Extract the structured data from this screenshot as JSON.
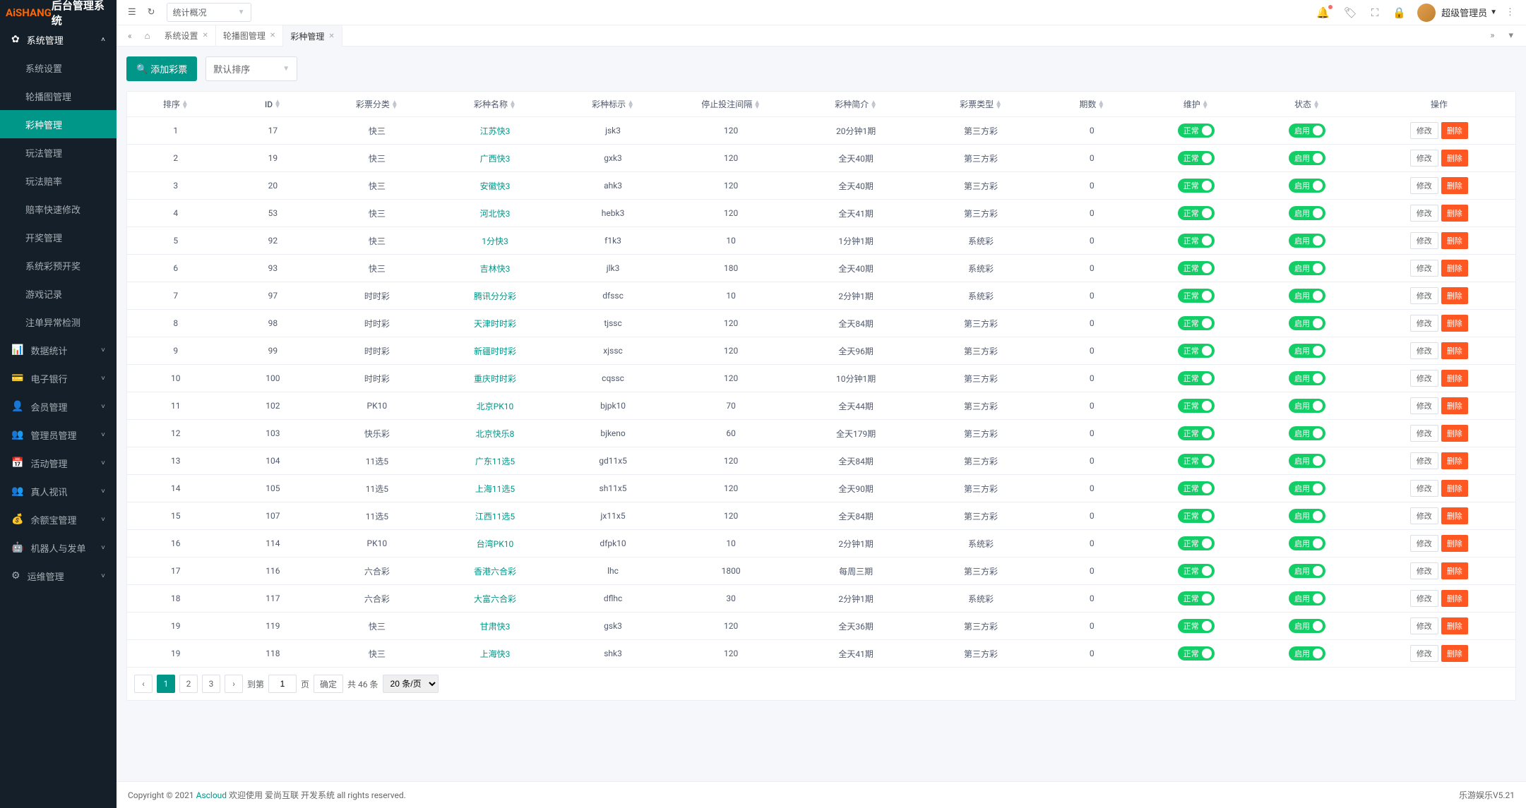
{
  "logo": {
    "part1": "AiSHANG",
    "part2": "后台管理系统"
  },
  "topbar": {
    "dropdown_label": "统计概况",
    "user_name": "超级管理员"
  },
  "tabs": [
    {
      "label": "系统设置",
      "active": false
    },
    {
      "label": "轮播图管理",
      "active": false
    },
    {
      "label": "彩种管理",
      "active": true
    }
  ],
  "sidebar": {
    "group1_label": "系统管理",
    "items": [
      {
        "label": "系统设置"
      },
      {
        "label": "轮播图管理"
      },
      {
        "label": "彩种管理"
      },
      {
        "label": "玩法管理"
      },
      {
        "label": "玩法赔率"
      },
      {
        "label": "赔率快速修改"
      },
      {
        "label": "开奖管理"
      },
      {
        "label": "系统彩预开奖"
      },
      {
        "label": "游戏记录"
      },
      {
        "label": "注单异常检测"
      }
    ],
    "collapsed_groups": [
      {
        "icon": "📊",
        "label": "数据统计"
      },
      {
        "icon": "💳",
        "label": "电子银行"
      },
      {
        "icon": "👤",
        "label": "会员管理"
      },
      {
        "icon": "👥",
        "label": "管理员管理"
      },
      {
        "icon": "📅",
        "label": "活动管理"
      },
      {
        "icon": "👥",
        "label": "真人视讯"
      },
      {
        "icon": "💰",
        "label": "余额宝管理"
      },
      {
        "icon": "🤖",
        "label": "机器人与发单"
      },
      {
        "icon": "⚙",
        "label": "运维管理"
      }
    ]
  },
  "toolbar": {
    "add_label": "添加彩票",
    "sort_label": "默认排序"
  },
  "table": {
    "headers": [
      "排序",
      "ID",
      "彩票分类",
      "彩种名称",
      "彩种标示",
      "停止投注间隔",
      "彩种简介",
      "彩票类型",
      "期数",
      "维护",
      "状态",
      "操作"
    ],
    "toggle_maintain": "正常",
    "toggle_status": "启用",
    "btn_edit": "修改",
    "btn_delete": "删除",
    "rows": [
      {
        "sort": "1",
        "id": "17",
        "cat": "快三",
        "name": "江苏快3",
        "code": "jsk3",
        "stop": "120",
        "intro": "20分钟1期",
        "type": "第三方彩",
        "periods": "0"
      },
      {
        "sort": "2",
        "id": "19",
        "cat": "快三",
        "name": "广西快3",
        "code": "gxk3",
        "stop": "120",
        "intro": "全天40期",
        "type": "第三方彩",
        "periods": "0"
      },
      {
        "sort": "3",
        "id": "20",
        "cat": "快三",
        "name": "安徽快3",
        "code": "ahk3",
        "stop": "120",
        "intro": "全天40期",
        "type": "第三方彩",
        "periods": "0"
      },
      {
        "sort": "4",
        "id": "53",
        "cat": "快三",
        "name": "河北快3",
        "code": "hebk3",
        "stop": "120",
        "intro": "全天41期",
        "type": "第三方彩",
        "periods": "0"
      },
      {
        "sort": "5",
        "id": "92",
        "cat": "快三",
        "name": "1分快3",
        "code": "f1k3",
        "stop": "10",
        "intro": "1分钟1期",
        "type": "系统彩",
        "periods": "0"
      },
      {
        "sort": "6",
        "id": "93",
        "cat": "快三",
        "name": "吉林快3",
        "code": "jlk3",
        "stop": "180",
        "intro": "全天40期",
        "type": "系统彩",
        "periods": "0"
      },
      {
        "sort": "7",
        "id": "97",
        "cat": "时时彩",
        "name": "腾讯分分彩",
        "code": "dfssc",
        "stop": "10",
        "intro": "2分钟1期",
        "type": "系统彩",
        "periods": "0"
      },
      {
        "sort": "8",
        "id": "98",
        "cat": "时时彩",
        "name": "天津时时彩",
        "code": "tjssc",
        "stop": "120",
        "intro": "全天84期",
        "type": "第三方彩",
        "periods": "0"
      },
      {
        "sort": "9",
        "id": "99",
        "cat": "时时彩",
        "name": "新疆时时彩",
        "code": "xjssc",
        "stop": "120",
        "intro": "全天96期",
        "type": "第三方彩",
        "periods": "0"
      },
      {
        "sort": "10",
        "id": "100",
        "cat": "时时彩",
        "name": "重庆时时彩",
        "code": "cqssc",
        "stop": "120",
        "intro": "10分钟1期",
        "type": "第三方彩",
        "periods": "0"
      },
      {
        "sort": "11",
        "id": "102",
        "cat": "PK10",
        "name": "北京PK10",
        "code": "bjpk10",
        "stop": "70",
        "intro": "全天44期",
        "type": "第三方彩",
        "periods": "0"
      },
      {
        "sort": "12",
        "id": "103",
        "cat": "快乐彩",
        "name": "北京快乐8",
        "code": "bjkeno",
        "stop": "60",
        "intro": "全天179期",
        "type": "第三方彩",
        "periods": "0"
      },
      {
        "sort": "13",
        "id": "104",
        "cat": "11选5",
        "name": "广东11选5",
        "code": "gd11x5",
        "stop": "120",
        "intro": "全天84期",
        "type": "第三方彩",
        "periods": "0"
      },
      {
        "sort": "14",
        "id": "105",
        "cat": "11选5",
        "name": "上海11选5",
        "code": "sh11x5",
        "stop": "120",
        "intro": "全天90期",
        "type": "第三方彩",
        "periods": "0"
      },
      {
        "sort": "15",
        "id": "107",
        "cat": "11选5",
        "name": "江西11选5",
        "code": "jx11x5",
        "stop": "120",
        "intro": "全天84期",
        "type": "第三方彩",
        "periods": "0"
      },
      {
        "sort": "16",
        "id": "114",
        "cat": "PK10",
        "name": "台湾PK10",
        "code": "dfpk10",
        "stop": "10",
        "intro": "2分钟1期",
        "type": "系统彩",
        "periods": "0"
      },
      {
        "sort": "17",
        "id": "116",
        "cat": "六合彩",
        "name": "香港六合彩",
        "code": "lhc",
        "stop": "1800",
        "intro": "每周三期",
        "type": "第三方彩",
        "periods": "0"
      },
      {
        "sort": "18",
        "id": "117",
        "cat": "六合彩",
        "name": "大富六合彩",
        "code": "dflhc",
        "stop": "30",
        "intro": "2分钟1期",
        "type": "系统彩",
        "periods": "0"
      },
      {
        "sort": "19",
        "id": "119",
        "cat": "快三",
        "name": "甘肃快3",
        "code": "gsk3",
        "stop": "120",
        "intro": "全天36期",
        "type": "第三方彩",
        "periods": "0"
      },
      {
        "sort": "19",
        "id": "118",
        "cat": "快三",
        "name": "上海快3",
        "code": "shk3",
        "stop": "120",
        "intro": "全天41期",
        "type": "第三方彩",
        "periods": "0"
      }
    ]
  },
  "pagination": {
    "pages": [
      "1",
      "2",
      "3"
    ],
    "goto_label": "到第",
    "page_label": "页",
    "confirm": "确定",
    "total_prefix": "共",
    "total_count": "46",
    "total_suffix": "条",
    "page_size": "20 条/页",
    "current_page": "1"
  },
  "footer": {
    "left_prefix": "Copyright © 2021 ",
    "link": "Ascloud",
    "left_suffix": " 欢迎使用 爱尚互联 开发系统 all rights reserved.",
    "right": "乐游娱乐V5.21"
  }
}
